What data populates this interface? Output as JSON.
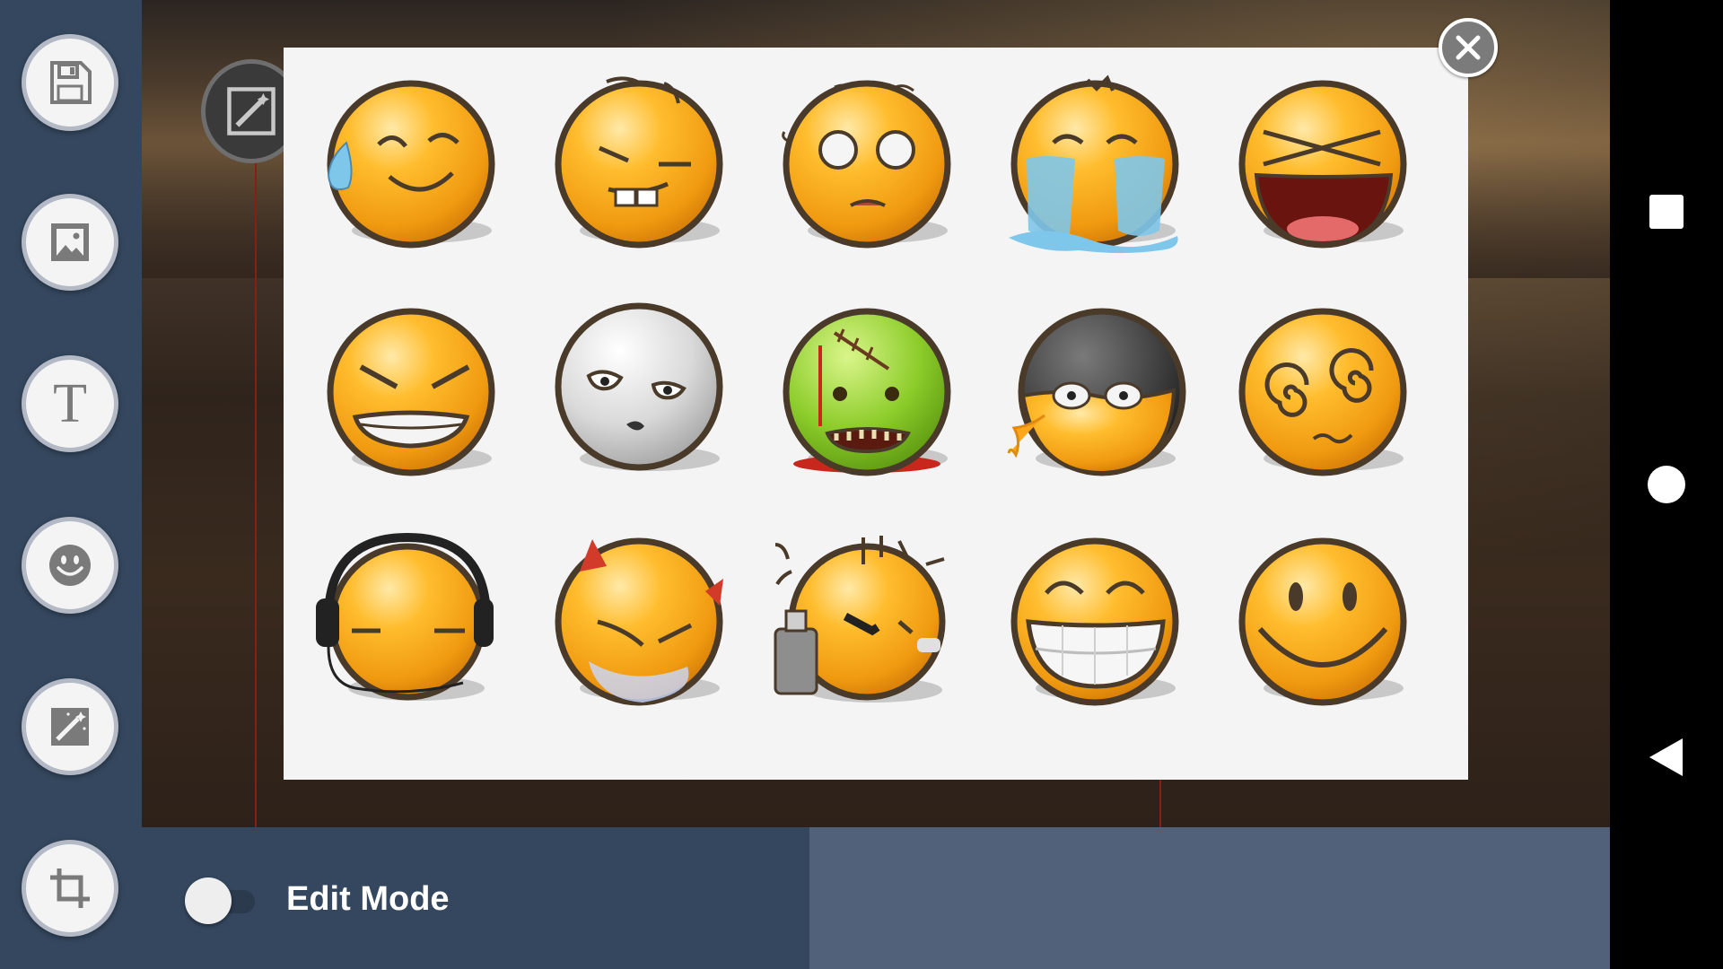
{
  "toolbar": {
    "tools": [
      {
        "name": "save",
        "icon": "save-icon"
      },
      {
        "name": "image",
        "icon": "image-icon"
      },
      {
        "name": "text",
        "icon": "text-icon",
        "glyph": "T"
      },
      {
        "name": "sticker",
        "icon": "smiley-icon"
      },
      {
        "name": "magic",
        "icon": "magic-wand-icon"
      },
      {
        "name": "crop",
        "icon": "crop-icon"
      }
    ]
  },
  "bottom_bar": {
    "edit_mode_label": "Edit Mode",
    "edit_mode_on": false
  },
  "sticker_dialog": {
    "stickers": [
      "sweat-smile-emoji",
      "toothy-squint-emoji",
      "dazed-emoji",
      "crying-emoji",
      "xd-laugh-emoji",
      "grimace-emoji",
      "ghost-emoji",
      "zombie-emoji",
      "cracked-egg-emoji",
      "dizzy-emoji",
      "headphones-emoji",
      "devil-emoji",
      "spray-can-emoji",
      "big-grin-emoji",
      "smiley-emoji"
    ]
  },
  "navigation": {
    "buttons": [
      "recents-icon",
      "home-icon",
      "back-icon"
    ]
  },
  "colors": {
    "rail": "#34475e",
    "bottom_right": "#516179",
    "emoji_yellow": "#f4a81a",
    "dialog_bg": "#f4f4f4"
  }
}
